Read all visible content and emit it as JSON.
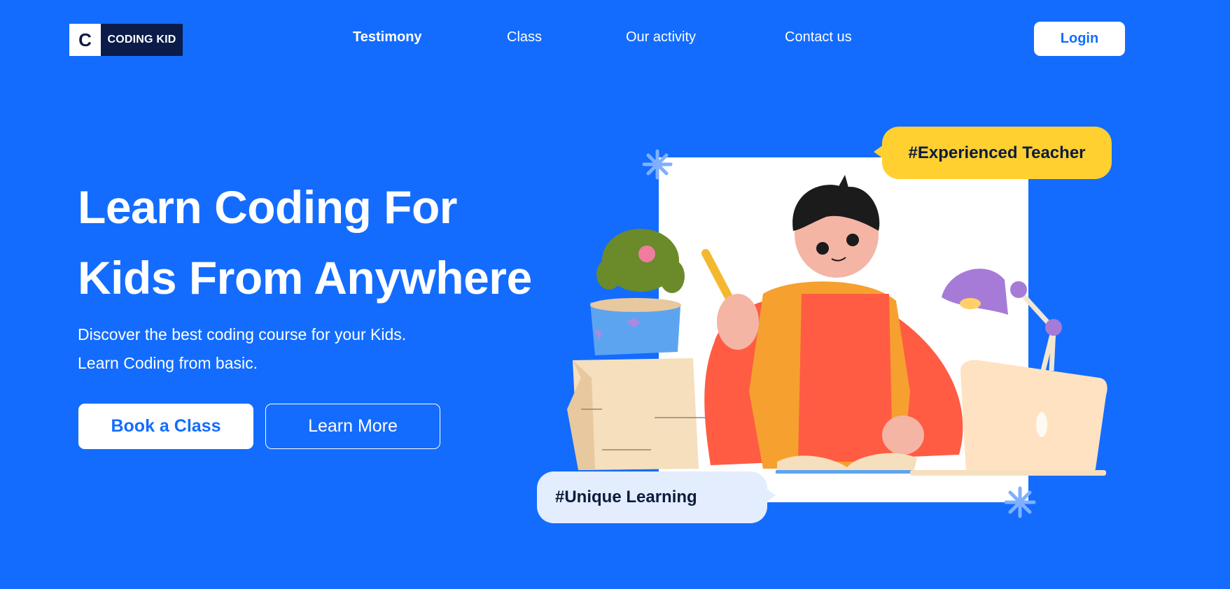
{
  "brand": {
    "logo_letter": "C",
    "name": "CODING KID"
  },
  "nav": {
    "items": [
      {
        "label": "Testimony",
        "active": true
      },
      {
        "label": "Class",
        "active": false
      },
      {
        "label": "Our activity",
        "active": false
      },
      {
        "label": "Contact us",
        "active": false
      }
    ]
  },
  "header": {
    "login_label": "Login"
  },
  "hero": {
    "title_line1": "Learn Coding For",
    "title_line2": "Kids From Anywhere",
    "subtitle_line1": "Discover the best coding course for your Kids.",
    "subtitle_line2": "Learn Coding from basic.",
    "primary_cta": "Book a Class",
    "secondary_cta": "Learn More"
  },
  "illustration": {
    "tag_top": "#Experienced Teacher",
    "tag_bottom": "#Unique Learning"
  },
  "colors": {
    "background": "#136CFE",
    "logo_dark": "#0b1c4a",
    "tag_yellow": "#FFD02F",
    "tag_light": "#E3EDFE"
  }
}
